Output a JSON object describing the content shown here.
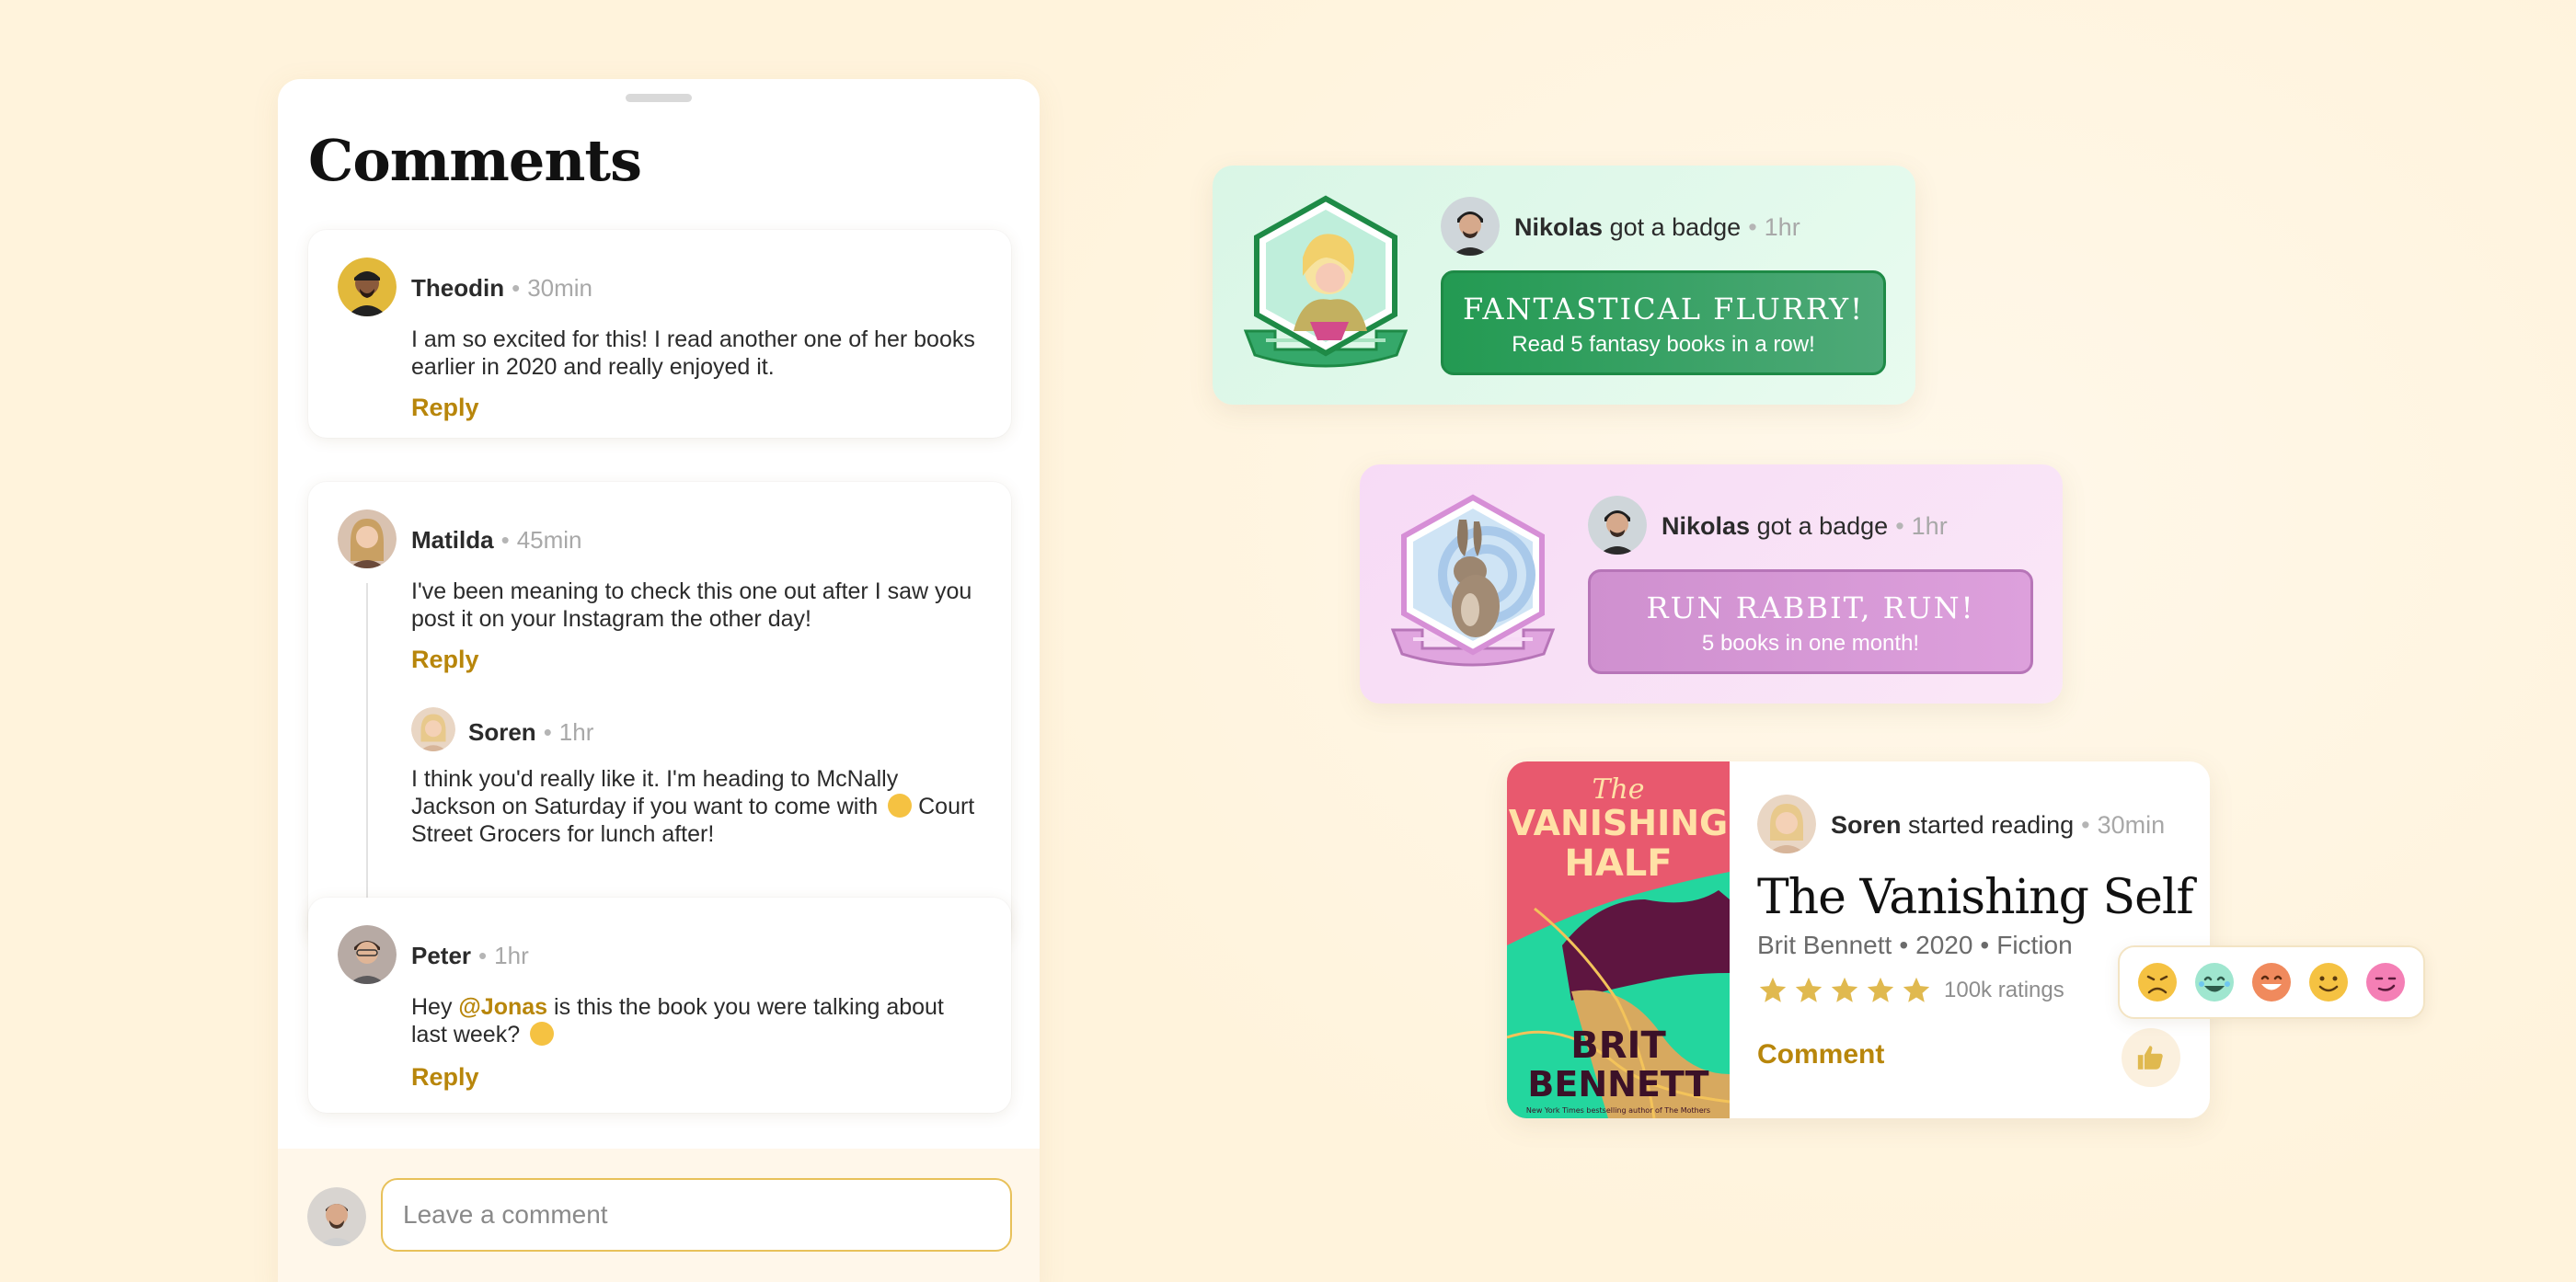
{
  "panel": {
    "title": "Comments",
    "comments": [
      {
        "name": "Theodin",
        "time": "30min",
        "text": "I am so excited for this! I read another one of her books earlier in 2020 and really enjoyed it.",
        "reply_label": "Reply"
      },
      {
        "name": "Matilda",
        "time": "45min",
        "text": "I've been meaning to check this one out after I saw you post it on your Instagram the other day!",
        "reply_label": "Reply",
        "replies": [
          {
            "name": "Soren",
            "time": "1hr",
            "text_before": "I think you'd really like it. I'm heading to McNally Jackson on Saturday if you want to come with",
            "text_after": "Court Street Grocers for lunch after!"
          }
        ]
      },
      {
        "name": "Peter",
        "time": "1hr",
        "text_before": "Hey",
        "mention": "@Jonas",
        "text_after": "is this the book you were talking about last week?",
        "reply_label": "Reply"
      }
    ],
    "input": {
      "placeholder": "Leave a comment"
    }
  },
  "badges": [
    {
      "user": "Nikolas",
      "action": "got a badge",
      "time": "1hr",
      "title": "FANTASTICAL FLURRY!",
      "subtitle": "Read 5 fantasy books in a row!",
      "accent": "#239a52"
    },
    {
      "user": "Nikolas",
      "action": "got a badge",
      "time": "1hr",
      "title": "RUN RABBIT, RUN!",
      "subtitle": "5 books in one month!",
      "accent": "#cf90cf"
    }
  ],
  "book": {
    "user": "Soren",
    "action": "started reading",
    "time": "30min",
    "title": "The Vanishing Self",
    "author": "Brit Bennett",
    "year": "2020",
    "genre": "Fiction",
    "rating": 5,
    "ratings_count": "100k ratings",
    "comment_label": "Comment",
    "cover": {
      "small_title": "The",
      "big_title_1": "VANISHING",
      "big_title_2": "HALF",
      "author_1": "BRIT",
      "author_2": "BENNETT",
      "tagline": "New York Times bestselling author of The Mothers"
    },
    "reactions": [
      "sad-face-icon",
      "laughing-tears-icon",
      "grinning-face-icon",
      "smiling-face-icon",
      "smirking-face-icon"
    ]
  },
  "colors": {
    "background": "#fff3dc",
    "accent_gold": "#b8860b",
    "input_border": "#e8c15a",
    "star": "#e0b94f"
  }
}
